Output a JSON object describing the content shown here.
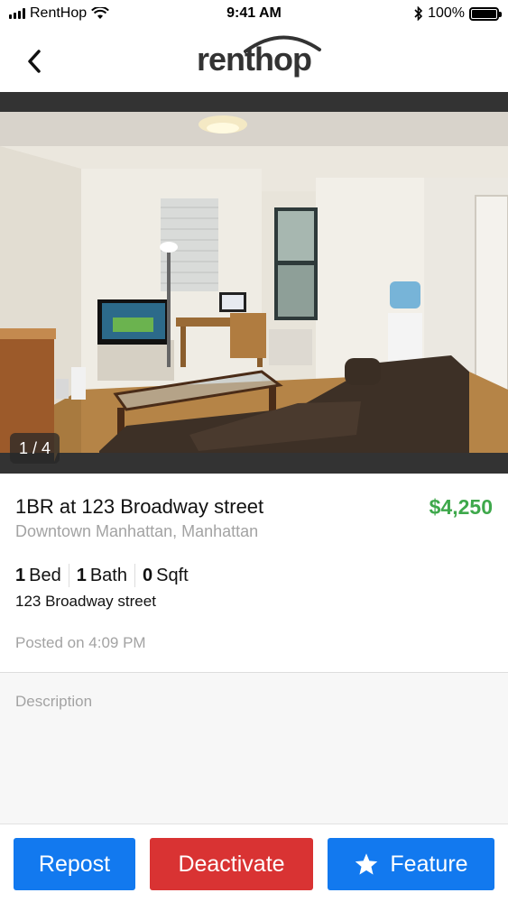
{
  "status_bar": {
    "carrier": "RentHop",
    "time": "9:41 AM",
    "battery": "100%",
    "battery_level": 1.0
  },
  "nav": {
    "logo_text": "renthop",
    "back_icon": "chevron-left-icon"
  },
  "photo": {
    "counter": "1 / 4"
  },
  "listing": {
    "title": "1BR at 123 Broadway street",
    "price": "$4,250",
    "neighborhood": "Downtown Manhattan, Manhattan",
    "beds_value": "1",
    "beds_label": "Bed",
    "baths_value": "1",
    "baths_label": "Bath",
    "sqft_value": "0",
    "sqft_label": "Sqft",
    "address": "123 Broadway street",
    "posted": "Posted on 4:09 PM"
  },
  "description": {
    "label": "Description"
  },
  "actions": {
    "repost": "Repost",
    "deactivate": "Deactivate",
    "feature": "Feature",
    "feature_icon": "star-icon"
  },
  "colors": {
    "price_green": "#3ea84b",
    "primary_blue": "#1279ef",
    "danger_red": "#d93333",
    "muted_gray": "#a3a3a3"
  }
}
